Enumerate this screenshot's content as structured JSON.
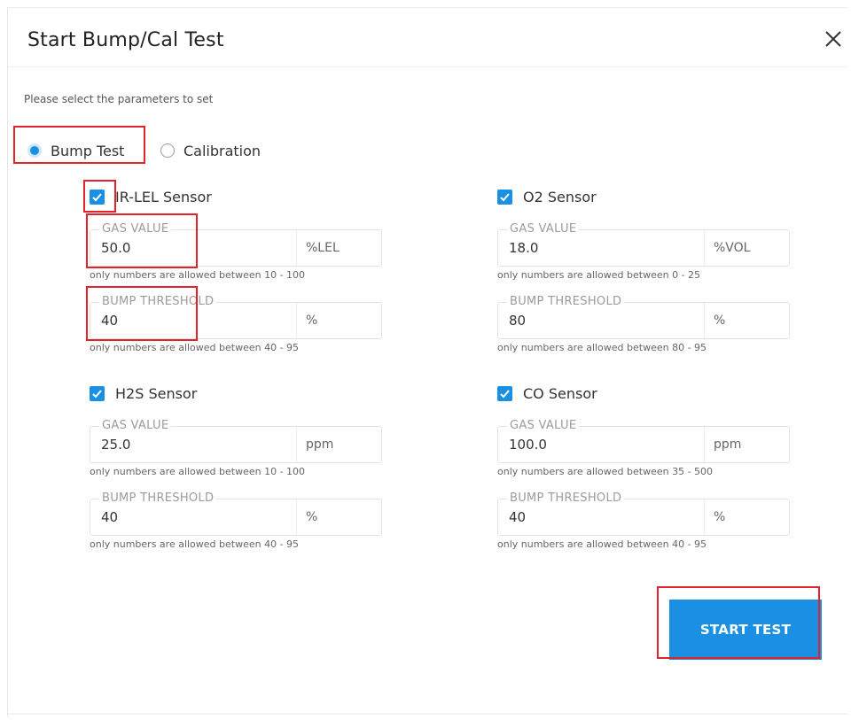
{
  "dialog": {
    "title": "Start Bump/Cal Test",
    "close_icon": "close-icon",
    "instructions": "Please select the parameters to set"
  },
  "mode": {
    "options": [
      {
        "label": "Bump Test",
        "selected": true
      },
      {
        "label": "Calibration",
        "selected": false
      }
    ]
  },
  "sensors": [
    {
      "name": "IR-LEL Sensor",
      "checked": true,
      "gas_value": {
        "label": "GAS VALUE",
        "value": "50.0",
        "unit": "%LEL",
        "hint": "only numbers are allowed between 10 - 100"
      },
      "bump_threshold": {
        "label": "BUMP THRESHOLD",
        "value": "40",
        "unit": "%",
        "hint": "only numbers are allowed between 40 - 95"
      }
    },
    {
      "name": "O2 Sensor",
      "checked": true,
      "gas_value": {
        "label": "GAS VALUE",
        "value": "18.0",
        "unit": "%VOL",
        "hint": "only numbers are allowed between 0 - 25"
      },
      "bump_threshold": {
        "label": "BUMP THRESHOLD",
        "value": "80",
        "unit": "%",
        "hint": "only numbers are allowed between 80 - 95"
      }
    },
    {
      "name": "H2S Sensor",
      "checked": true,
      "gas_value": {
        "label": "GAS VALUE",
        "value": "25.0",
        "unit": "ppm",
        "hint": "only numbers are allowed between 10 - 100"
      },
      "bump_threshold": {
        "label": "BUMP THRESHOLD",
        "value": "40",
        "unit": "%",
        "hint": "only numbers are allowed between 40 - 95"
      }
    },
    {
      "name": "CO Sensor",
      "checked": true,
      "gas_value": {
        "label": "GAS VALUE",
        "value": "100.0",
        "unit": "ppm",
        "hint": "only numbers are allowed between 35 - 500"
      },
      "bump_threshold": {
        "label": "BUMP THRESHOLD",
        "value": "40",
        "unit": "%",
        "hint": "only numbers are allowed between 40 - 95"
      }
    }
  ],
  "actions": {
    "start_label": "START TEST"
  },
  "colors": {
    "accent": "#1a8fe3",
    "highlight": "#e0242a"
  }
}
